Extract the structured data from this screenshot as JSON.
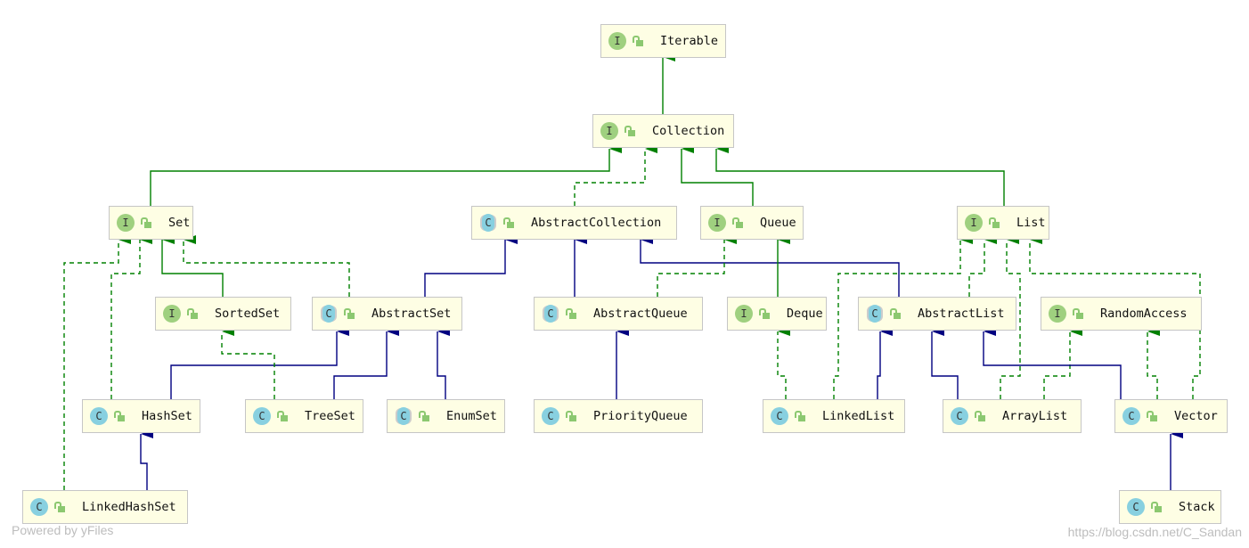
{
  "colors": {
    "inheritance": "#000080",
    "implementation": "#008000",
    "node_fill": "#fefee4",
    "node_border": "#c6c6c6"
  },
  "nodes": [
    {
      "id": "Iterable",
      "kind": "interface",
      "badge": "I"
    },
    {
      "id": "Collection",
      "kind": "interface",
      "badge": "I"
    },
    {
      "id": "Set",
      "kind": "interface",
      "badge": "I"
    },
    {
      "id": "AbstractCollection",
      "kind": "abstract",
      "badge": "C"
    },
    {
      "id": "Queue",
      "kind": "interface",
      "badge": "I"
    },
    {
      "id": "List",
      "kind": "interface",
      "badge": "I"
    },
    {
      "id": "SortedSet",
      "kind": "interface",
      "badge": "I"
    },
    {
      "id": "AbstractSet",
      "kind": "abstract",
      "badge": "C"
    },
    {
      "id": "AbstractQueue",
      "kind": "abstract",
      "badge": "C"
    },
    {
      "id": "Deque",
      "kind": "interface",
      "badge": "I"
    },
    {
      "id": "AbstractList",
      "kind": "abstract",
      "badge": "C"
    },
    {
      "id": "RandomAccess",
      "kind": "interface",
      "badge": "I"
    },
    {
      "id": "HashSet",
      "kind": "class",
      "badge": "C"
    },
    {
      "id": "TreeSet",
      "kind": "class",
      "badge": "C"
    },
    {
      "id": "EnumSet",
      "kind": "abstract",
      "badge": "C"
    },
    {
      "id": "PriorityQueue",
      "kind": "class",
      "badge": "C"
    },
    {
      "id": "LinkedList",
      "kind": "class",
      "badge": "C"
    },
    {
      "id": "ArrayList",
      "kind": "class",
      "badge": "C"
    },
    {
      "id": "Vector",
      "kind": "class",
      "badge": "C"
    },
    {
      "id": "LinkedHashSet",
      "kind": "class",
      "badge": "C"
    },
    {
      "id": "Stack",
      "kind": "class",
      "badge": "C"
    }
  ],
  "edges": [
    {
      "from": "Collection",
      "to": "Iterable",
      "type": "extends-interface"
    },
    {
      "from": "Set",
      "to": "Collection",
      "type": "extends-interface"
    },
    {
      "from": "AbstractCollection",
      "to": "Collection",
      "type": "implements"
    },
    {
      "from": "Queue",
      "to": "Collection",
      "type": "extends-interface"
    },
    {
      "from": "List",
      "to": "Collection",
      "type": "extends-interface"
    },
    {
      "from": "SortedSet",
      "to": "Set",
      "type": "extends-interface"
    },
    {
      "from": "AbstractSet",
      "to": "Set",
      "type": "implements"
    },
    {
      "from": "HashSet",
      "to": "Set",
      "type": "implements"
    },
    {
      "from": "LinkedHashSet",
      "to": "Set",
      "type": "implements"
    },
    {
      "from": "AbstractSet",
      "to": "AbstractCollection",
      "type": "extends"
    },
    {
      "from": "AbstractQueue",
      "to": "AbstractCollection",
      "type": "extends"
    },
    {
      "from": "AbstractList",
      "to": "AbstractCollection",
      "type": "extends"
    },
    {
      "from": "AbstractQueue",
      "to": "Queue",
      "type": "implements"
    },
    {
      "from": "Deque",
      "to": "Queue",
      "type": "extends-interface"
    },
    {
      "from": "HashSet",
      "to": "AbstractSet",
      "type": "extends"
    },
    {
      "from": "TreeSet",
      "to": "AbstractSet",
      "type": "extends"
    },
    {
      "from": "EnumSet",
      "to": "AbstractSet",
      "type": "extends"
    },
    {
      "from": "TreeSet",
      "to": "SortedSet",
      "type": "implements"
    },
    {
      "from": "LinkedHashSet",
      "to": "HashSet",
      "type": "extends"
    },
    {
      "from": "PriorityQueue",
      "to": "AbstractQueue",
      "type": "extends"
    },
    {
      "from": "LinkedList",
      "to": "Deque",
      "type": "implements"
    },
    {
      "from": "LinkedList",
      "to": "List",
      "type": "implements"
    },
    {
      "from": "LinkedList",
      "to": "AbstractList",
      "type": "extends"
    },
    {
      "from": "AbstractList",
      "to": "List",
      "type": "implements"
    },
    {
      "from": "ArrayList",
      "to": "AbstractList",
      "type": "extends"
    },
    {
      "from": "ArrayList",
      "to": "List",
      "type": "implements"
    },
    {
      "from": "ArrayList",
      "to": "RandomAccess",
      "type": "implements"
    },
    {
      "from": "Vector",
      "to": "AbstractList",
      "type": "extends"
    },
    {
      "from": "Vector",
      "to": "RandomAccess",
      "type": "implements"
    },
    {
      "from": "Vector",
      "to": "List",
      "type": "implements"
    },
    {
      "from": "Stack",
      "to": "Vector",
      "type": "extends"
    }
  ],
  "watermarks": {
    "left": "Powered by yFiles",
    "right": "https://blog.csdn.net/C_Sandan"
  }
}
